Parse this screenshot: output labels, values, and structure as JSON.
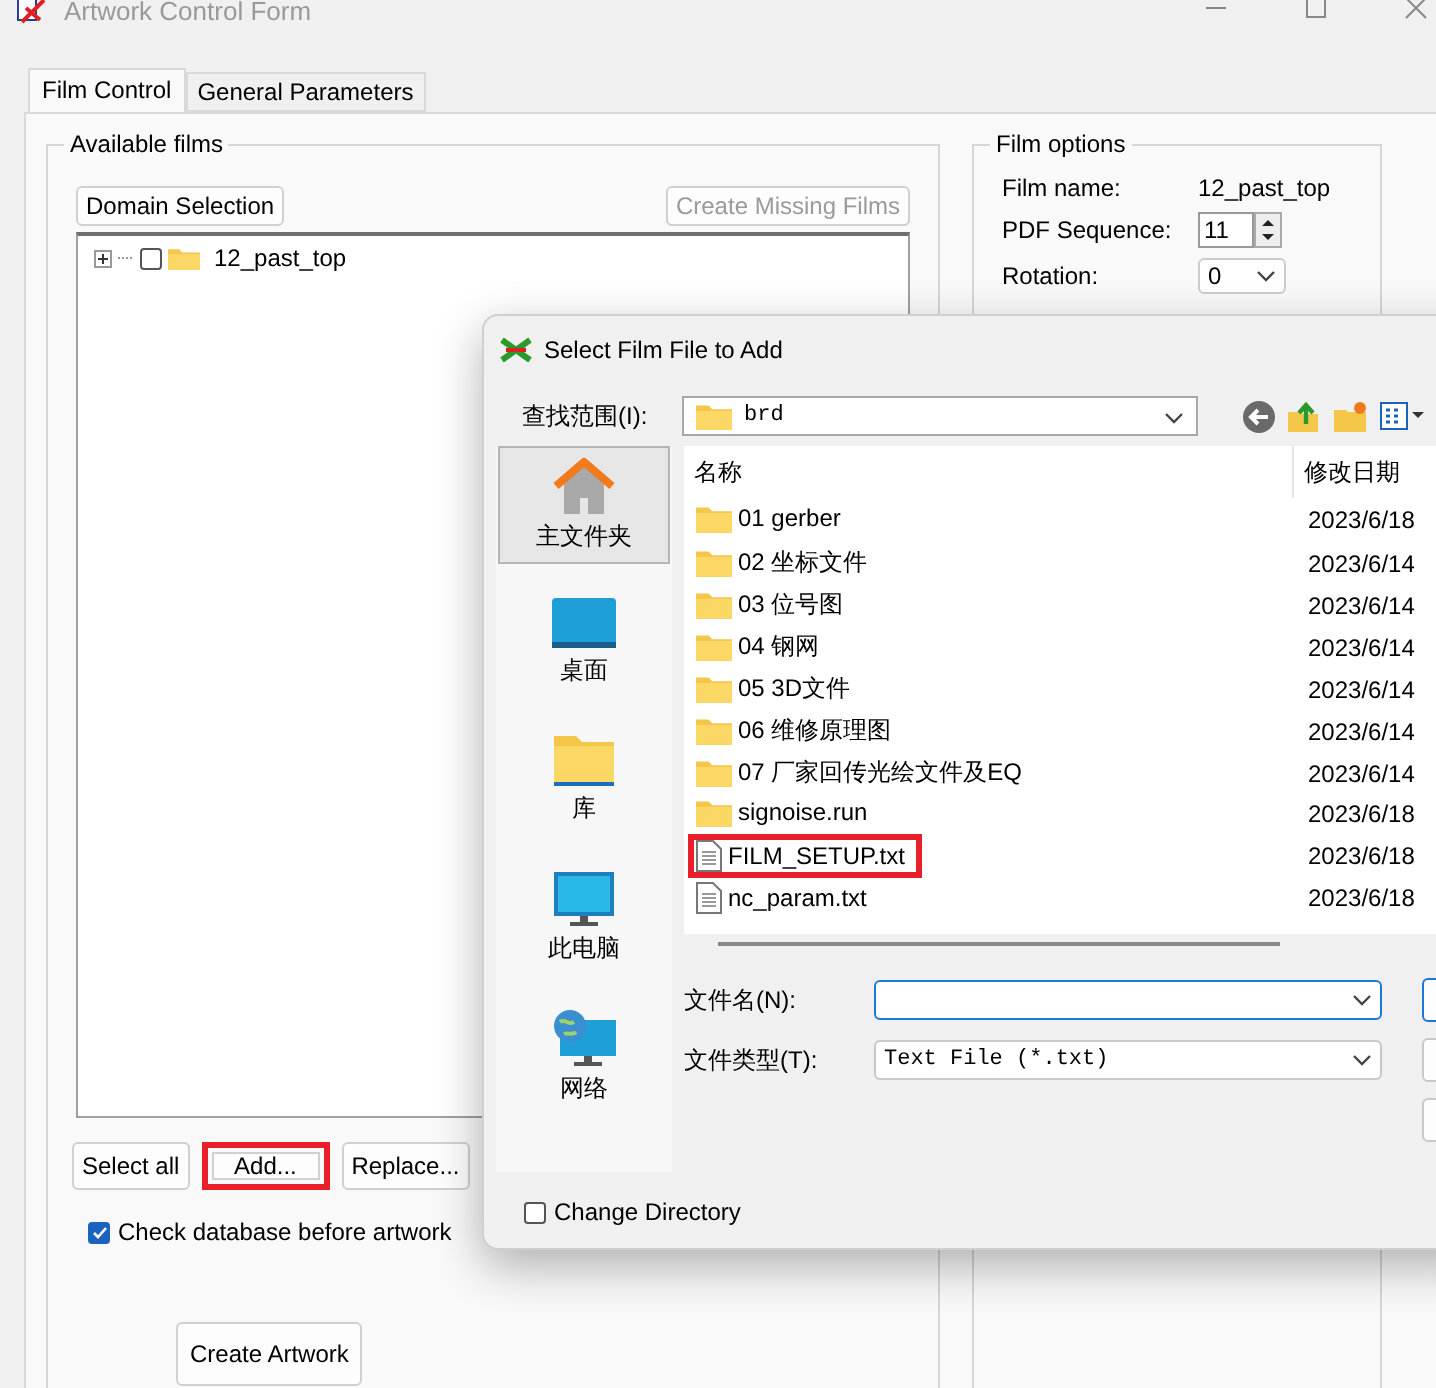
{
  "window": {
    "title": "Artwork Control Form"
  },
  "tabs": [
    {
      "label": "Film Control",
      "selected": true
    },
    {
      "label": "General Parameters",
      "selected": false
    }
  ],
  "available_films": {
    "title": "Available films",
    "domain_button": "Domain Selection",
    "create_missing_button": {
      "label": "Create Missing Films",
      "disabled": true
    },
    "tree": [
      {
        "label": "12_past_top",
        "checked": false,
        "expanded": false
      }
    ],
    "buttons": [
      {
        "label": "Select all",
        "highlighted": false
      },
      {
        "label": "Add...",
        "highlighted": true
      },
      {
        "label": "Replace...",
        "highlighted": false
      }
    ],
    "check_database": {
      "label": "Check database before artwork",
      "checked": true
    },
    "create_artwork_button": "Create Artwork"
  },
  "film_options": {
    "title": "Film options",
    "film_name_label": "Film name:",
    "film_name": "12_past_top",
    "pdf_sequence_label": "PDF Sequence:",
    "pdf_sequence": "11",
    "rotation_label": "Rotation:",
    "rotation": "0"
  },
  "dialog": {
    "title": "Select Film File to Add",
    "look_in_label": "查找范围(I):",
    "look_in": "brd",
    "places": [
      {
        "label": "主文件夹",
        "kind": "home",
        "selected": true
      },
      {
        "label": "桌面",
        "kind": "desktop",
        "selected": false
      },
      {
        "label": "库",
        "kind": "library",
        "selected": false
      },
      {
        "label": "此电脑",
        "kind": "computer",
        "selected": false
      },
      {
        "label": "网络",
        "kind": "network",
        "selected": false
      }
    ],
    "columns": [
      "名称",
      "修改日期"
    ],
    "files": [
      {
        "name": "01 gerber",
        "date": "2023/6/18",
        "kind": "folder",
        "highlighted": false
      },
      {
        "name": "02 坐标文件",
        "date": "2023/6/14",
        "kind": "folder",
        "highlighted": false
      },
      {
        "name": "03 位号图",
        "date": "2023/6/14",
        "kind": "folder",
        "highlighted": false
      },
      {
        "name": "04 钢网",
        "date": "2023/6/14",
        "kind": "folder",
        "highlighted": false
      },
      {
        "name": "05 3D文件",
        "date": "2023/6/14",
        "kind": "folder",
        "highlighted": false
      },
      {
        "name": "06 维修原理图",
        "date": "2023/6/14",
        "kind": "folder",
        "highlighted": false
      },
      {
        "name": "07 厂家回传光绘文件及EQ",
        "date": "2023/6/14",
        "kind": "folder",
        "highlighted": false
      },
      {
        "name": "signoise.run",
        "date": "2023/6/18",
        "kind": "folder",
        "highlighted": false
      },
      {
        "name": "FILM_SETUP.txt",
        "date": "2023/6/18",
        "kind": "file",
        "highlighted": true
      },
      {
        "name": "nc_param.txt",
        "date": "2023/6/18",
        "kind": "file",
        "highlighted": false
      }
    ],
    "file_name_label": "文件名(N):",
    "file_type_label": "文件类型(T):",
    "file_type": "Text File (*.txt)",
    "change_directory": {
      "label": "Change Directory",
      "checked": false
    }
  }
}
